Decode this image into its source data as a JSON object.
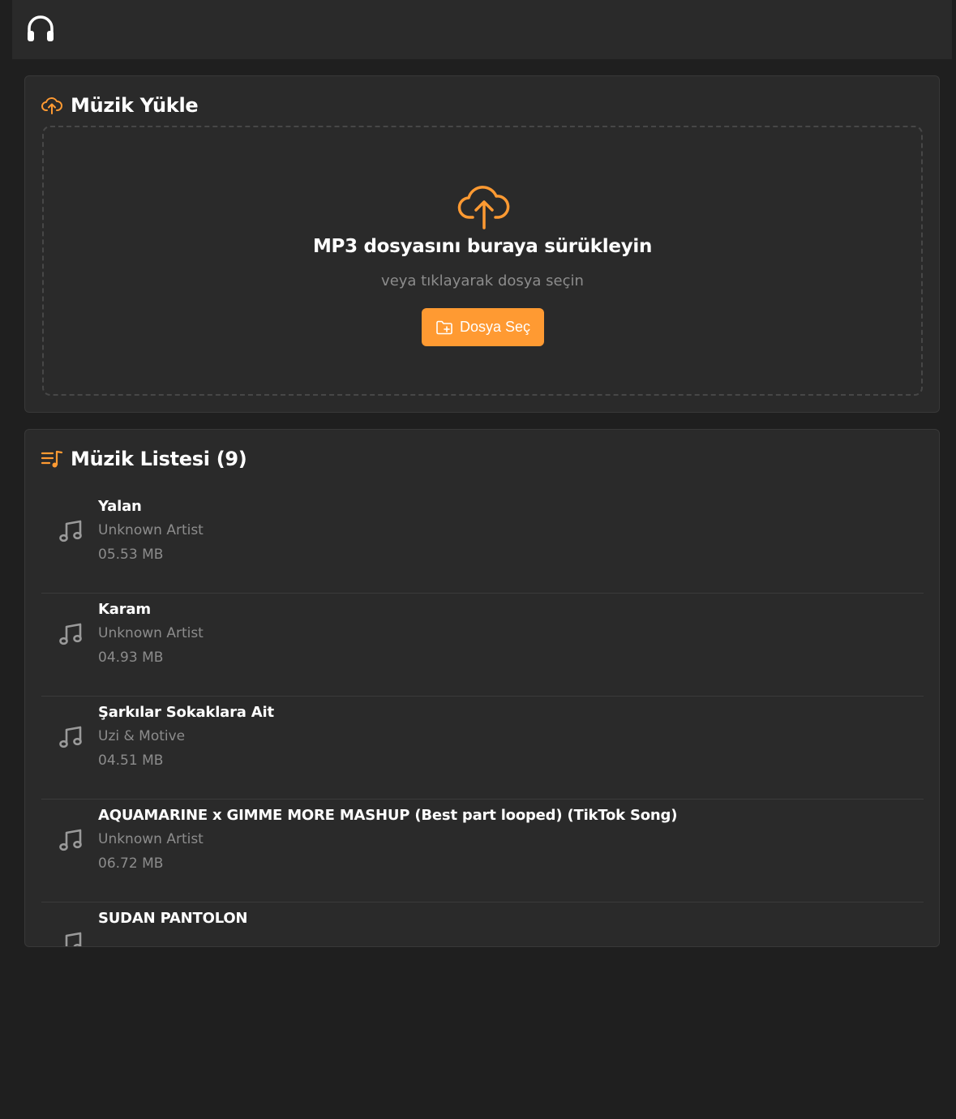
{
  "app": {
    "logo_icon": "headphones-icon"
  },
  "upload": {
    "title": "Müzik Yükle",
    "title_icon": "cloud-upload-icon",
    "drop_title": "MP3 dosyasını buraya sürükleyin",
    "drop_subtitle": "veya tıklayarak dosya seçin",
    "button_label": "Dosya Seç",
    "button_icon": "folder-add-icon"
  },
  "library": {
    "title": "Müzik Listesi (9)",
    "title_icon": "playlist-icon",
    "tracks": [
      {
        "title": "Yalan",
        "artist": "Unknown Artist",
        "size": "05.53 MB"
      },
      {
        "title": "Karam",
        "artist": "Unknown Artist",
        "size": "04.93 MB"
      },
      {
        "title": "Şarkılar Sokaklara Ait",
        "artist": "Uzi & Motive",
        "size": "04.51 MB"
      },
      {
        "title": "AQUAMARINE x GIMME MORE MASHUP (Best part looped) (TikTok Song)",
        "artist": "Unknown Artist",
        "size": "06.72 MB"
      },
      {
        "title": "SUDAN PANTOLON",
        "artist": "",
        "size": ""
      }
    ]
  },
  "colors": {
    "accent": "#ff9a32",
    "background": "#1f1f1f",
    "card": "#2a2a2a",
    "muted_text": "#8c8c8c"
  }
}
